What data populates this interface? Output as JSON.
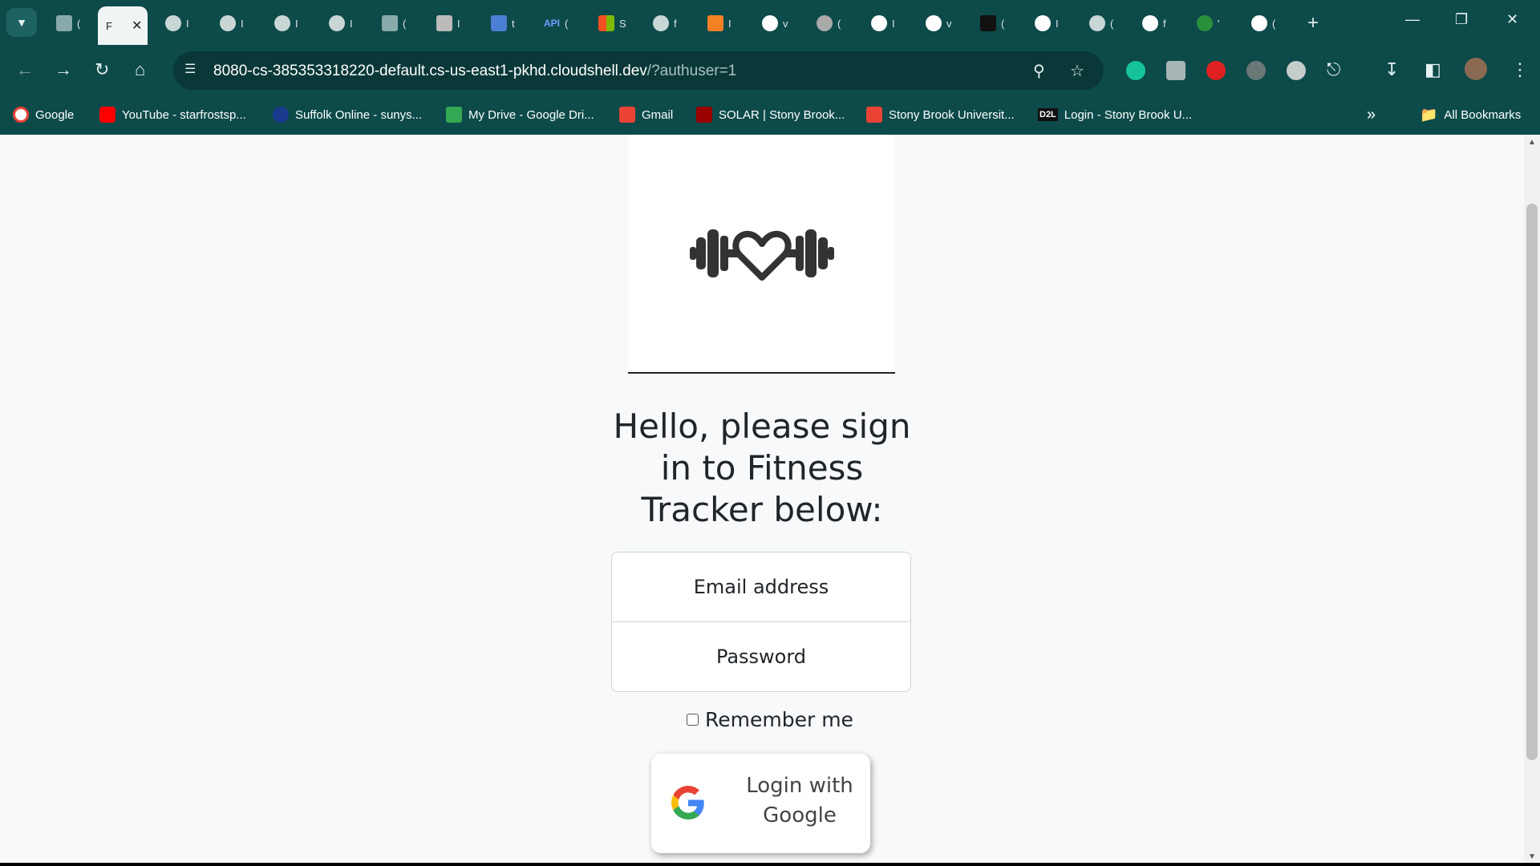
{
  "browser": {
    "active_tab_letter": "F",
    "url_host": "8080-cs-385353318220-default.cs-us-east1-pkhd.cloudshell.dev",
    "url_path": "/?authuser=1",
    "tab_letters": [
      "(",
      "I",
      "I",
      "I",
      "I",
      "(",
      "I",
      "t",
      "(",
      "S",
      "f",
      "I",
      "v",
      "(",
      "I",
      "v",
      "(",
      "I",
      "(",
      "f",
      "'",
      "("
    ],
    "api_tab_label": "API"
  },
  "bookmarks": [
    {
      "label": "Google",
      "color": "#ea4335"
    },
    {
      "label": "YouTube - starfrostsp...",
      "color": "#ff0000"
    },
    {
      "label": "Suffolk Online - sunys...",
      "color": "#1a3a8f"
    },
    {
      "label": "My Drive - Google Dri...",
      "color": "#34a853"
    },
    {
      "label": "Gmail",
      "color": "#ea4335"
    },
    {
      "label": "SOLAR | Stony Brook...",
      "color": "#990000"
    },
    {
      "label": "Stony Brook Universit...",
      "color": "#ea4335"
    },
    {
      "label": "Login - Stony Brook U...",
      "color": "#111111"
    }
  ],
  "bookmark_d2l": "D2L",
  "all_bookmarks_label": "All Bookmarks",
  "page": {
    "heading": "Hello, please sign in to Fitness Tracker below:",
    "email_placeholder": "Email address",
    "password_placeholder": "Password",
    "remember_label": "Remember me",
    "google_button_label": "Login with Google"
  }
}
